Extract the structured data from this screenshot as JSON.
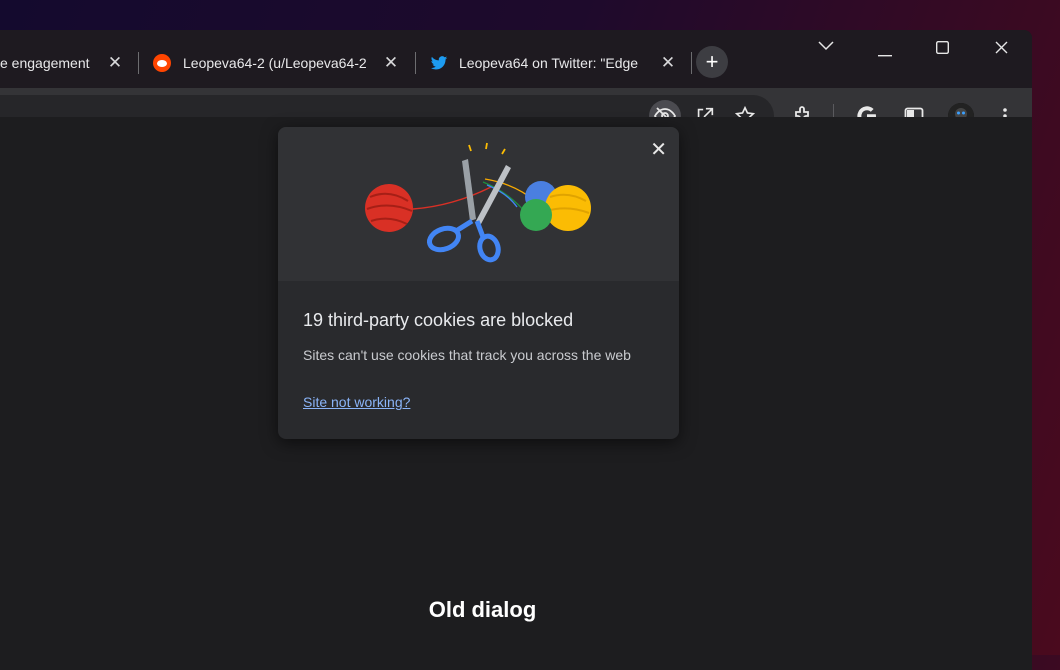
{
  "tabs": [
    {
      "title": "e engagement"
    },
    {
      "title": "Leopeva64-2 (u/Leopeva64-2"
    },
    {
      "title": "Leopeva64 on Twitter: \"Edge"
    }
  ],
  "tab_close_glyph": "✕",
  "new_tab_glyph": "+",
  "window_controls": {
    "dropdown": "⌵",
    "minimize": "—",
    "maximize": "☐",
    "close": "✕"
  },
  "toolbar_icons": [
    "eye-off-icon",
    "share-icon",
    "star-icon",
    "extension-icon",
    "google-icon",
    "side-panel-icon",
    "avatar",
    "more-icon"
  ],
  "popup": {
    "close_glyph": "✕",
    "title": "19 third-party cookies are blocked",
    "description": "Sites can't use cookies that track you across the web",
    "link": "Site not working?"
  },
  "caption": "Old dialog",
  "colors": {
    "accent_link": "#8ab4f8",
    "twitter_blue": "#1d9bf0",
    "reddit_orange": "#ff4500"
  }
}
